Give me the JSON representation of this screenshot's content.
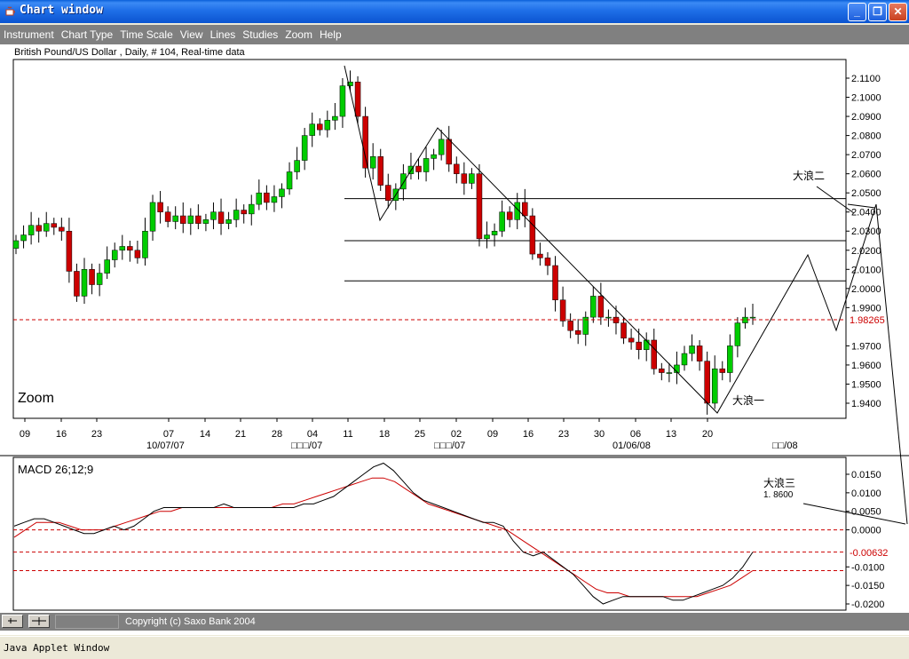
{
  "window": {
    "title": "Chart window",
    "applet_label": "Java Applet Window"
  },
  "menu": [
    "Instrument",
    "Chart Type",
    "Time Scale",
    "View",
    "Lines",
    "Studies",
    "Zoom",
    "Help"
  ],
  "status": {
    "copyright": "Copyright (c) Saxo Bank 2004"
  },
  "chart": {
    "header": "British Pound/US Dollar , Daily, # 104, Real-time data",
    "zoom_label": "Zoom",
    "current_price": "1.98265",
    "annotations": {
      "wave1": "大浪一",
      "wave2": "大浪二",
      "wave3": "大浪三",
      "wave3_target": "1. 8600"
    },
    "date_labels": [
      "10/07/07",
      "□□□/07",
      "□□□/07",
      "01/06/08",
      "□□/08"
    ],
    "macd_label": "MACD 26;12;9",
    "macd_current": "-0.00632"
  },
  "colors": {
    "up": "#00cc00",
    "down": "#cc0000",
    "accent": "#cc0000"
  },
  "chart_data": {
    "type": "candlestick",
    "ylim": [
      1.93,
      2.12
    ],
    "y_ticks": [
      2.11,
      2.1,
      2.09,
      2.08,
      2.07,
      2.06,
      2.05,
      2.04,
      2.03,
      2.02,
      2.01,
      2.0,
      1.99,
      1.97,
      1.96,
      1.95,
      1.94
    ],
    "y_tick_labels": [
      "2.1100",
      "2.1000",
      "2.0900",
      "2.0800",
      "2.0700",
      "2.0600",
      "2.0500",
      "2.0400",
      "2.0300",
      "2.0200",
      "2.0100",
      "2.0000",
      "1.9900",
      "1.9700",
      "1.9600",
      "1.9500",
      "1.9400"
    ],
    "x_tick_labels": [
      "09",
      "16",
      "23",
      "07",
      "14",
      "21",
      "28",
      "04",
      "11",
      "18",
      "25",
      "02",
      "09",
      "16",
      "23",
      "30",
      "06",
      "13",
      "20"
    ],
    "horizontal_levels": [
      2.047,
      2.025,
      2.004
    ],
    "candles_close": [
      2.025,
      2.028,
      2.033,
      2.03,
      2.034,
      2.032,
      2.03,
      2.009,
      1.996,
      2.01,
      2.002,
      2.008,
      2.015,
      2.02,
      2.022,
      2.02,
      2.016,
      2.03,
      2.045,
      2.04,
      2.035,
      2.038,
      2.034,
      2.038,
      2.034,
      2.036,
      2.04,
      2.034,
      2.036,
      2.041,
      2.039,
      2.044,
      2.05,
      2.045,
      2.048,
      2.052,
      2.061,
      2.067,
      2.08,
      2.086,
      2.083,
      2.088,
      2.09,
      2.106,
      2.108,
      2.09,
      2.063,
      2.069,
      2.054,
      2.046,
      2.052,
      2.06,
      2.064,
      2.061,
      2.068,
      2.07,
      2.078,
      2.065,
      2.06,
      2.055,
      2.06,
      2.026,
      2.028,
      2.03,
      2.04,
      2.036,
      2.045,
      2.038,
      2.018,
      2.016,
      2.012,
      1.994,
      1.983,
      1.978,
      1.976,
      1.985,
      1.996,
      1.985,
      1.985,
      1.982,
      1.974,
      1.972,
      1.968,
      1.973,
      1.958,
      1.956,
      1.956,
      1.96,
      1.966,
      1.97,
      1.962,
      1.94,
      1.958,
      1.956,
      1.97,
      1.982,
      1.985,
      1.985
    ],
    "macd": {
      "ylim": [
        -0.022,
        0.018
      ],
      "y_ticks": [
        0.015,
        0.01,
        0.005,
        0.0,
        -0.01,
        -0.015,
        -0.02
      ],
      "y_tick_labels": [
        "0.0150",
        "0.0100",
        "0.0050",
        "0.0000",
        "-0.0100",
        "-0.0150",
        "-0.0200"
      ],
      "levels": [
        0.0,
        -0.006,
        -0.011
      ],
      "macd_line": [
        0.001,
        0.002,
        0.003,
        0.003,
        0.002,
        0.001,
        0.0,
        -0.001,
        -0.001,
        0.0,
        0.001,
        0.0,
        0.001,
        0.003,
        0.005,
        0.006,
        0.006,
        0.006,
        0.006,
        0.006,
        0.006,
        0.007,
        0.006,
        0.006,
        0.006,
        0.006,
        0.006,
        0.006,
        0.006,
        0.007,
        0.007,
        0.008,
        0.009,
        0.011,
        0.013,
        0.015,
        0.017,
        0.018,
        0.016,
        0.013,
        0.01,
        0.008,
        0.007,
        0.006,
        0.005,
        0.004,
        0.003,
        0.002,
        0.002,
        0.001,
        -0.003,
        -0.006,
        -0.007,
        -0.006,
        -0.008,
        -0.01,
        -0.012,
        -0.015,
        -0.018,
        -0.02,
        -0.019,
        -0.018,
        -0.018,
        -0.018,
        -0.018,
        -0.018,
        -0.019,
        -0.019,
        -0.018,
        -0.017,
        -0.016,
        -0.015,
        -0.013,
        -0.01,
        -0.006
      ],
      "signal_line": [
        -0.002,
        0.0,
        0.002,
        0.002,
        0.002,
        0.001,
        0.0,
        0.0,
        0.0,
        0.001,
        0.002,
        0.003,
        0.004,
        0.005,
        0.005,
        0.006,
        0.006,
        0.006,
        0.006,
        0.006,
        0.006,
        0.006,
        0.006,
        0.006,
        0.007,
        0.007,
        0.008,
        0.009,
        0.01,
        0.011,
        0.012,
        0.013,
        0.014,
        0.014,
        0.013,
        0.011,
        0.009,
        0.007,
        0.006,
        0.005,
        0.004,
        0.003,
        0.002,
        0.001,
        0.0,
        -0.002,
        -0.004,
        -0.006,
        -0.008,
        -0.01,
        -0.012,
        -0.014,
        -0.016,
        -0.017,
        -0.017,
        -0.018,
        -0.018,
        -0.018,
        -0.018,
        -0.018,
        -0.018,
        -0.018,
        -0.017,
        -0.016,
        -0.015,
        -0.013,
        -0.011
      ]
    }
  }
}
